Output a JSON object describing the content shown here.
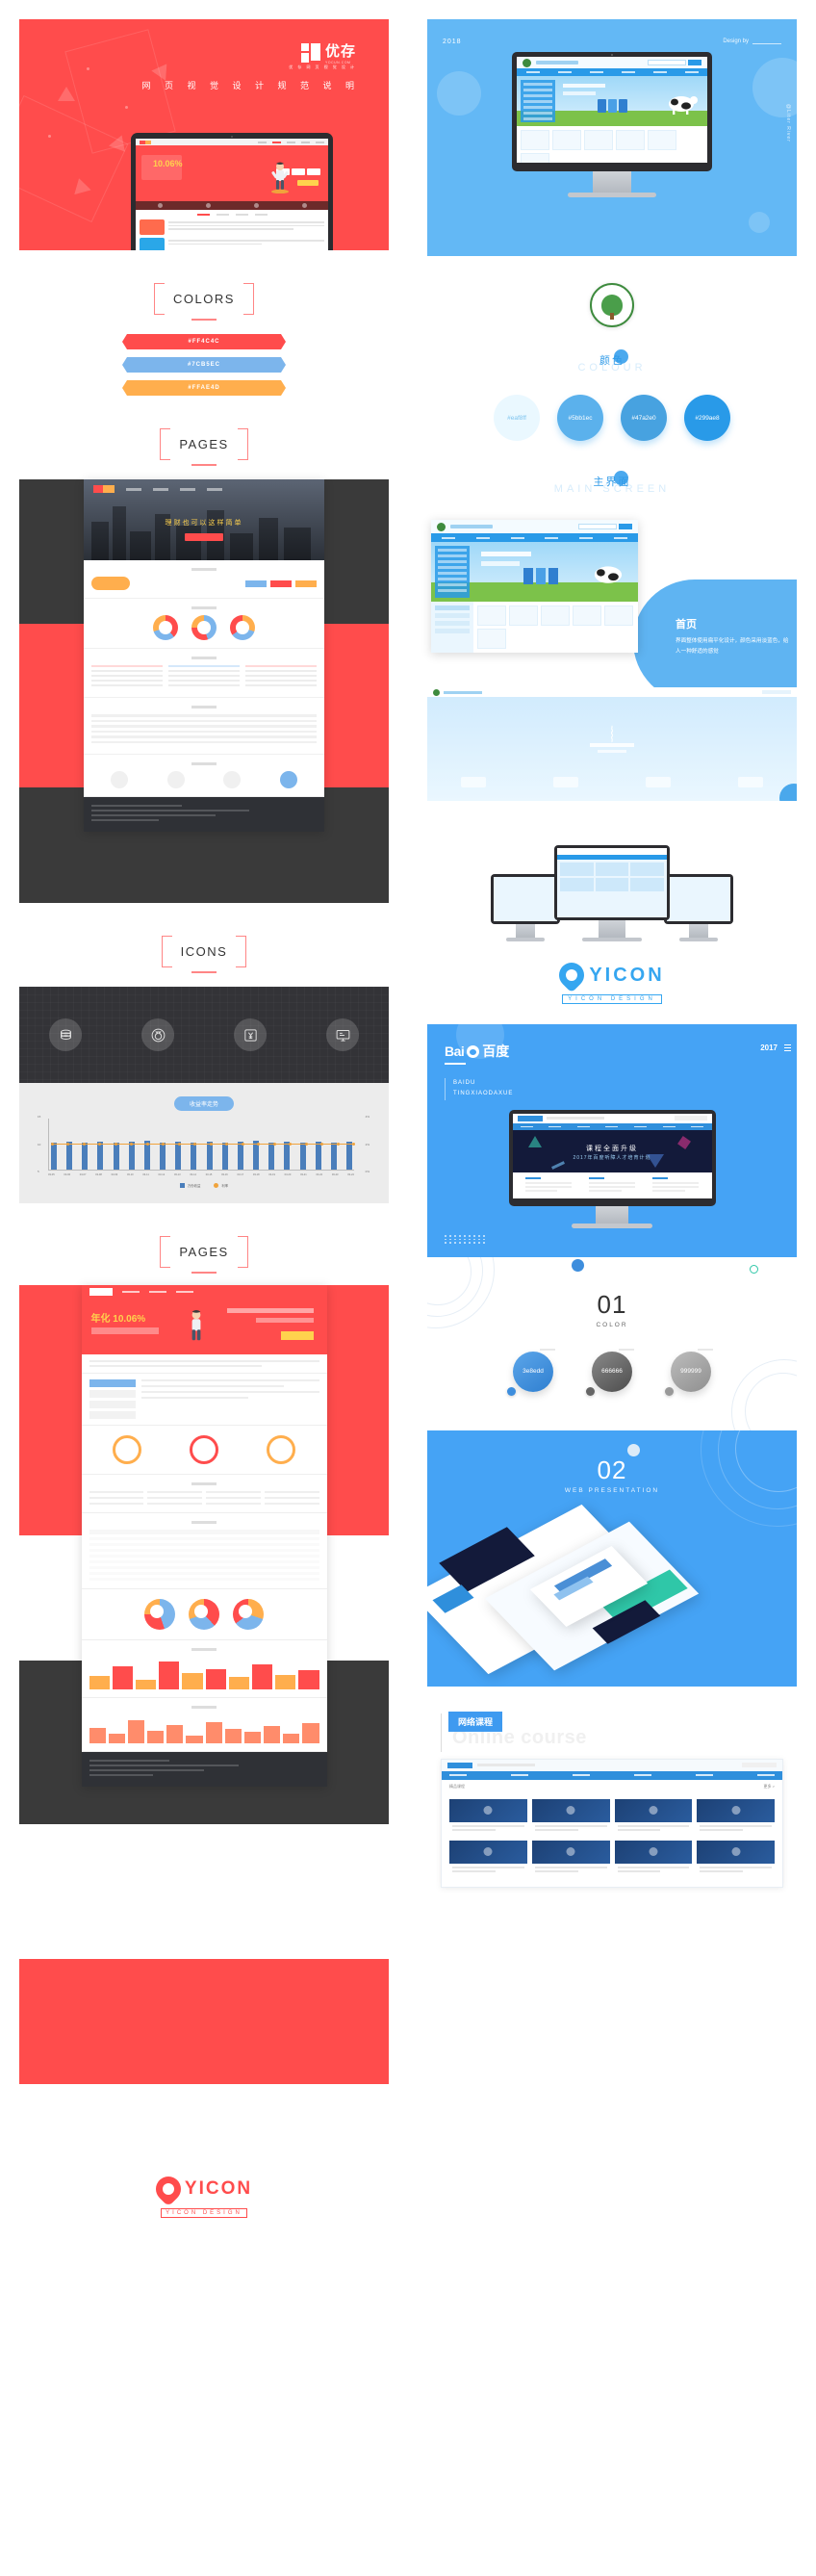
{
  "meta": {
    "doc_type": "design-portfolio-showcase"
  },
  "left": {
    "hero": {
      "brand_cn": "优存",
      "brand_en": "YOCUN.COM",
      "tagline_small": "优 存 网 页 视 觉 设 计",
      "title": "网 页 视 觉 设 计 规 范 说 明",
      "bg_color": "#ff4c4c"
    },
    "colors_section": {
      "title": "COLORS",
      "swatches": [
        {
          "hex": "#FF4C4C",
          "label": "#FF4C4C"
        },
        {
          "hex": "#7CB5EC",
          "label": "#7CB5EC"
        },
        {
          "hex": "#FFAE4D",
          "label": "#FFAE4D"
        }
      ]
    },
    "pages_section_1": {
      "title": "PAGES"
    },
    "icons_section": {
      "title": "ICONS",
      "icons": [
        {
          "name": "coins-stack-icon",
          "glyph": "☰"
        },
        {
          "name": "money-bag-icon",
          "glyph": "○"
        },
        {
          "name": "yuan-currency-icon",
          "glyph": "¥"
        },
        {
          "name": "monitor-report-icon",
          "glyph": "▤"
        }
      ]
    },
    "chart_panel": {
      "badge": "收益率走势"
    },
    "pages_section_2": {
      "title": "PAGES"
    },
    "footer_logo": {
      "text": "YICON",
      "sub": "YICON DESIGN",
      "color": "#ff4c4c"
    }
  },
  "right": {
    "hero": {
      "year": "2018",
      "design_by": "Design by",
      "vertical": "@Liter River",
      "bg_color": "#63b8f5"
    },
    "colour_section": {
      "cn": "颜色",
      "en": "COLOUR",
      "swatches": [
        {
          "hex": "#eaf8ff",
          "label": "#eaf8ff",
          "text_color": "#7fc4ef"
        },
        {
          "hex": "#5bb1ec",
          "label": "#5bb1ec",
          "text_color": "#ffffff"
        },
        {
          "hex": "#47a2e0",
          "label": "#47a2e0",
          "text_color": "#ffffff"
        },
        {
          "hex": "#299ae8",
          "label": "#299ae8",
          "text_color": "#ffffff"
        }
      ]
    },
    "main_screen_section": {
      "cn": "主界面",
      "en": "MAIN SCREEN",
      "callout_title": "首页",
      "callout_body": "界面整体使用扁平化设计，颜色采用淡蓝色，给人一种舒适的感觉"
    },
    "yicon_logo": {
      "text": "YICON",
      "sub": "YICON DESIGN",
      "color": "#35a6f0"
    },
    "baidu_section": {
      "brand_latin": "Bai",
      "brand_cn": "百度",
      "year": "2017",
      "en_line1": "BAIDU",
      "en_line2": "TINGXIAODAXUE",
      "banner_title": "课程全面升级",
      "banner_sub": "2017年百度听障人才培育计划"
    },
    "section_01": {
      "number": "01",
      "label": "COLOR",
      "swatches": [
        {
          "hex": "#3e8edd",
          "label": "3e8edd"
        },
        {
          "hex": "#666666",
          "label": "666666"
        },
        {
          "hex": "#999999",
          "label": "999999"
        }
      ]
    },
    "section_02": {
      "number": "02",
      "label": "WEB  PRESENTATION"
    },
    "online_course": {
      "tag": "网络课程",
      "ghost": "Online course"
    }
  },
  "chart_data": {
    "type": "bar",
    "title": "收益率走势",
    "categories": [
      "03-05",
      "03-06",
      "03-07",
      "03-08",
      "03-09",
      "03-10",
      "03-11",
      "03-12",
      "03-13",
      "03-14",
      "03-15",
      "03-16",
      "03-17",
      "03-18",
      "03-19",
      "03-20",
      "03-21",
      "03-22",
      "03-23",
      "03-24"
    ],
    "series": [
      {
        "name": "万份收益",
        "type": "bar",
        "color": "#4a7ebb",
        "values": [
          10.2,
          10.4,
          10.3,
          10.5,
          10.2,
          10.4,
          10.6,
          10.3,
          10.4,
          10.2,
          10.5,
          10.3,
          10.4,
          10.6,
          10.3,
          10.5,
          10.2,
          10.4,
          10.3,
          10.5
        ]
      },
      {
        "name": "利率",
        "type": "line",
        "color": "#f0a33c",
        "values": [
          2.0,
          2.0,
          2.0,
          2.0,
          2.0,
          2.0,
          2.0,
          2.0,
          2.0,
          2.0,
          2.0,
          2.0,
          2.0,
          2.0,
          2.0,
          2.0,
          2.0,
          2.0,
          2.0,
          2.0
        ]
      }
    ],
    "ylabel_left": "万份收益",
    "ylabel_right": "七日年化收益率",
    "ylim_left": [
      5,
      15
    ],
    "yticks_left": [
      "15",
      "10",
      "5"
    ],
    "yticks_right": [
      "4%",
      "2%",
      "0%"
    ],
    "grid": false,
    "legend_position": "bottom"
  }
}
